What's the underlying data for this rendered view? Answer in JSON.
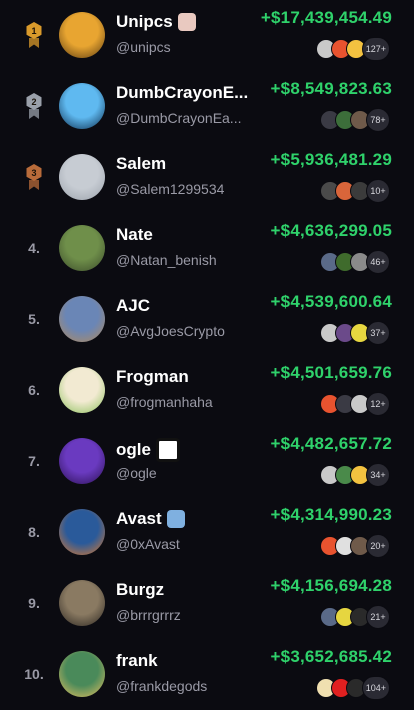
{
  "leaderboard": {
    "rows": [
      {
        "rank": "1",
        "medal": "gold",
        "name": "Unipcs",
        "handle": "@unipcs",
        "pnl": "+$17,439,454.49",
        "count": "127+",
        "badge": "pfp-badge",
        "avatar_colors": [
          "#e8a531",
          "#5a3a10"
        ],
        "chips": [
          "#c9c9c9",
          "#e8532f",
          "#f3c240"
        ]
      },
      {
        "rank": "2",
        "medal": "silver",
        "name": "DumbCrayonE...",
        "handle": "@DumbCrayonEa...",
        "pnl": "+$8,549,823.63",
        "count": "78+",
        "badge": "",
        "avatar_colors": [
          "#5fb9f0",
          "#0a2a4a"
        ],
        "chips": [
          "#3a3a44",
          "#3c6e3a",
          "#6f5a4a"
        ]
      },
      {
        "rank": "3",
        "medal": "bronze",
        "name": "Salem",
        "handle": "@Salem1299534",
        "pnl": "+$5,936,481.29",
        "count": "10+",
        "badge": "",
        "avatar_colors": [
          "#c7ccd3",
          "#9aa1aa"
        ],
        "chips": [
          "#4a4a4a",
          "#d9653a",
          "#3b3b3b"
        ]
      },
      {
        "rank": "4.",
        "medal": "",
        "name": "Nate",
        "handle": "@Natan_benish",
        "pnl": "+$4,636,299.05",
        "count": "46+",
        "badge": "",
        "avatar_colors": [
          "#6f8f4a",
          "#3a4a2a"
        ],
        "chips": [
          "#5a6a88",
          "#3f6b2c",
          "#8a8a8a"
        ]
      },
      {
        "rank": "5.",
        "medal": "",
        "name": "AJC",
        "handle": "@AvgJoesCrypto",
        "pnl": "+$4,539,600.64",
        "count": "37+",
        "badge": "",
        "avatar_colors": [
          "#6a86b6",
          "#b38a5a"
        ],
        "chips": [
          "#c9c9c9",
          "#6b4a8a",
          "#e6d640"
        ]
      },
      {
        "rank": "6.",
        "medal": "",
        "name": "Frogman",
        "handle": "@frogmanhaha",
        "pnl": "+$4,501,659.76",
        "count": "12+",
        "badge": "",
        "avatar_colors": [
          "#f2ead2",
          "#8ac05a"
        ],
        "chips": [
          "#e8532f",
          "#3a3a44",
          "#c9c9c9"
        ]
      },
      {
        "rank": "7.",
        "medal": "",
        "name": "ogle",
        "handle": "@ogle",
        "pnl": "+$4,482,657.72",
        "count": "34+",
        "badge": "cat-badge",
        "avatar_colors": [
          "#6a3ac0",
          "#2a1050"
        ],
        "chips": [
          "#c9c9c9",
          "#4a8a4a",
          "#f3c240"
        ]
      },
      {
        "rank": "8.",
        "medal": "",
        "name": "Avast",
        "handle": "@0xAvast",
        "pnl": "+$4,314,990.23",
        "count": "20+",
        "badge": "pfp-badge-blue",
        "avatar_colors": [
          "#2a5a9a",
          "#e07a2a"
        ],
        "chips": [
          "#e8532f",
          "#e0e0e0",
          "#6f5a4a"
        ]
      },
      {
        "rank": "9.",
        "medal": "",
        "name": "Burgz",
        "handle": "@brrrgrrrz",
        "pnl": "+$4,156,694.28",
        "count": "21+",
        "badge": "",
        "avatar_colors": [
          "#8a7a62",
          "#2a2520"
        ],
        "chips": [
          "#5a6a88",
          "#e6d640",
          "#2a2a2a"
        ]
      },
      {
        "rank": "10.",
        "medal": "",
        "name": "frank",
        "handle": "@frankdegods",
        "pnl": "+$3,652,685.42",
        "count": "104+",
        "badge": "",
        "avatar_colors": [
          "#4a8a5a",
          "#e8c060"
        ],
        "chips": [
          "#f0e0b0",
          "#e02020",
          "#2a2a2a"
        ]
      }
    ]
  },
  "colors": {
    "profit": "#2fd26b",
    "background": "#0b0b11",
    "muted": "#9a9aa6",
    "gold": "#d99a2b",
    "silver": "#9aa0aa",
    "bronze": "#b86b3a"
  }
}
